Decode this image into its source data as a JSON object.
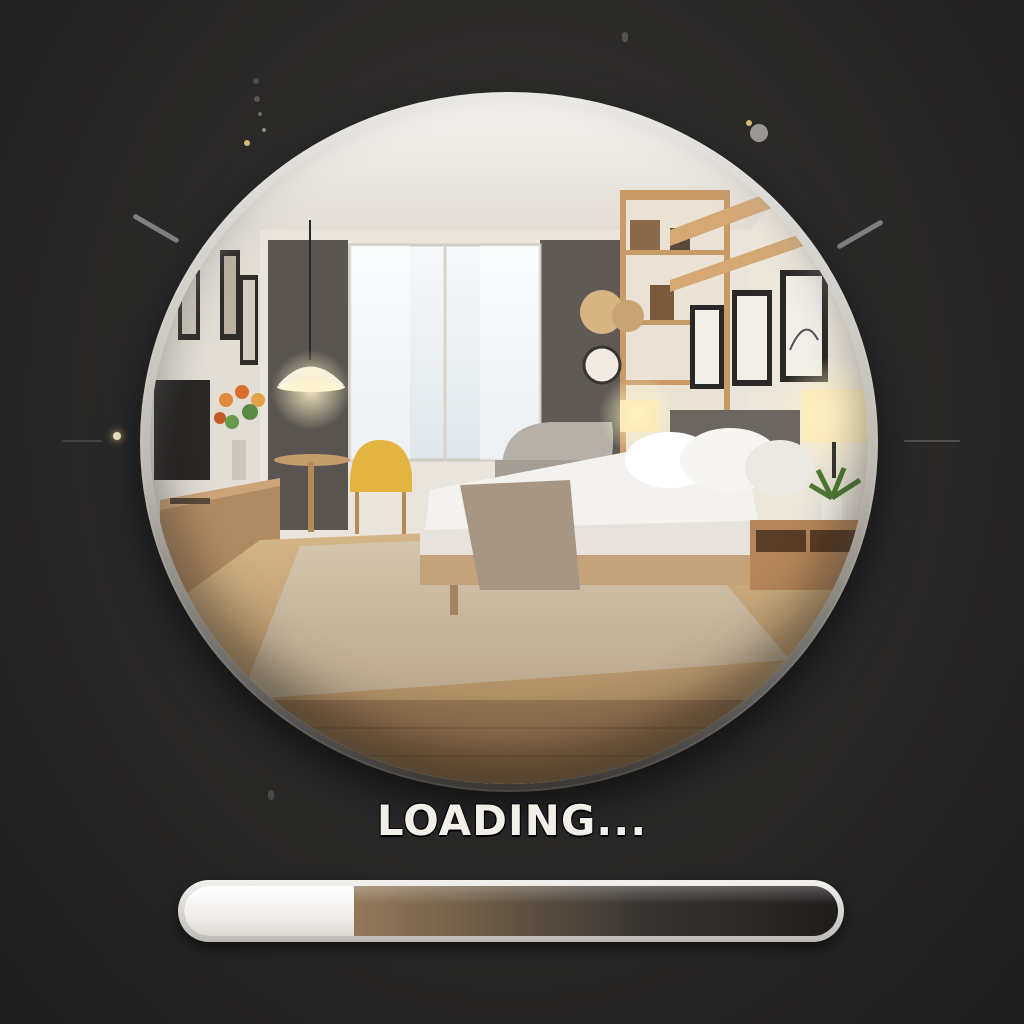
{
  "loading": {
    "label": "LOADING...",
    "progress_fraction": 0.26
  },
  "colors": {
    "background": "#2b2a29",
    "frame": "#e9e7e3",
    "text": "#f2efe9",
    "bar_accent": "#b89a6a",
    "bar_empty": "#1f1d1c"
  },
  "scene": {
    "icon": "bedroom-illustration"
  }
}
